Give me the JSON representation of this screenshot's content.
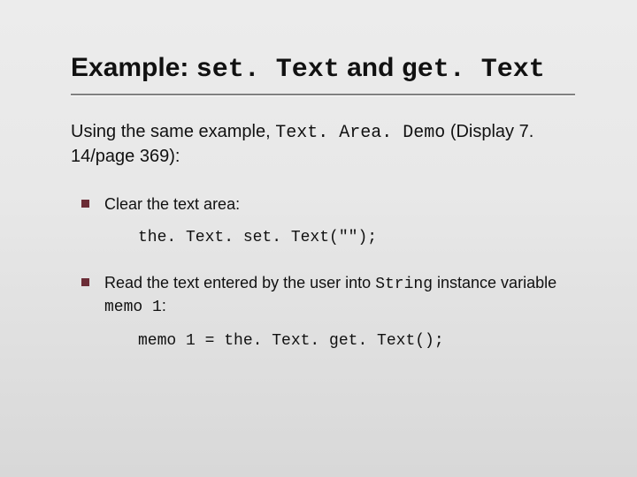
{
  "title": {
    "pre": "Example: ",
    "code1": "set. Text",
    "mid": " and ",
    "code2": "get. Text"
  },
  "intro": {
    "pre": "Using the same example, ",
    "code": "Text. Area. Demo",
    "post": " (Display 7. 14/page 369):"
  },
  "bullet1": {
    "text": "Clear the text area:",
    "code": "the. Text. set. Text(\"\");"
  },
  "bullet2": {
    "pre": "Read the text entered by the user into ",
    "code_inline1": "String",
    "mid": " instance variable ",
    "code_inline2": "memo 1",
    "post": ":",
    "code": "memo 1 = the. Text. get. Text();"
  }
}
